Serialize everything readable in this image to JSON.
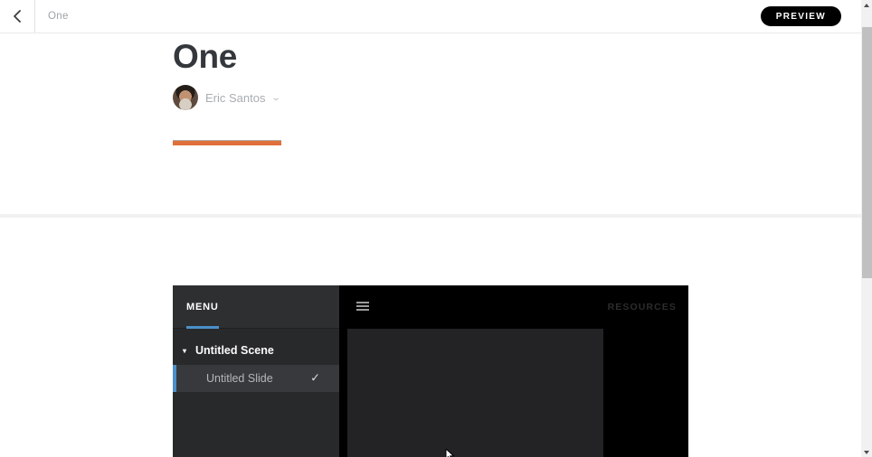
{
  "topbar": {
    "breadcrumb": "One",
    "preview_button": "PREVIEW"
  },
  "lesson": {
    "title": "One",
    "author_name": "Eric Santos"
  },
  "player": {
    "menu_tab_label": "MENU",
    "resources_label": "RESOURCES",
    "scene_title": "Untitled Scene",
    "slide_title": "Untitled Slide"
  },
  "icons": {
    "author_dropdown_chevron": "⌄",
    "scene_caret": "▾",
    "slide_check": "✓"
  },
  "colors": {
    "accent_orange": "#e0703b",
    "player_accent_blue": "#4a90c9",
    "preview_button_bg": "#000000",
    "sidebar_bg": "#28292b",
    "selected_slide_bg": "#38393c"
  }
}
